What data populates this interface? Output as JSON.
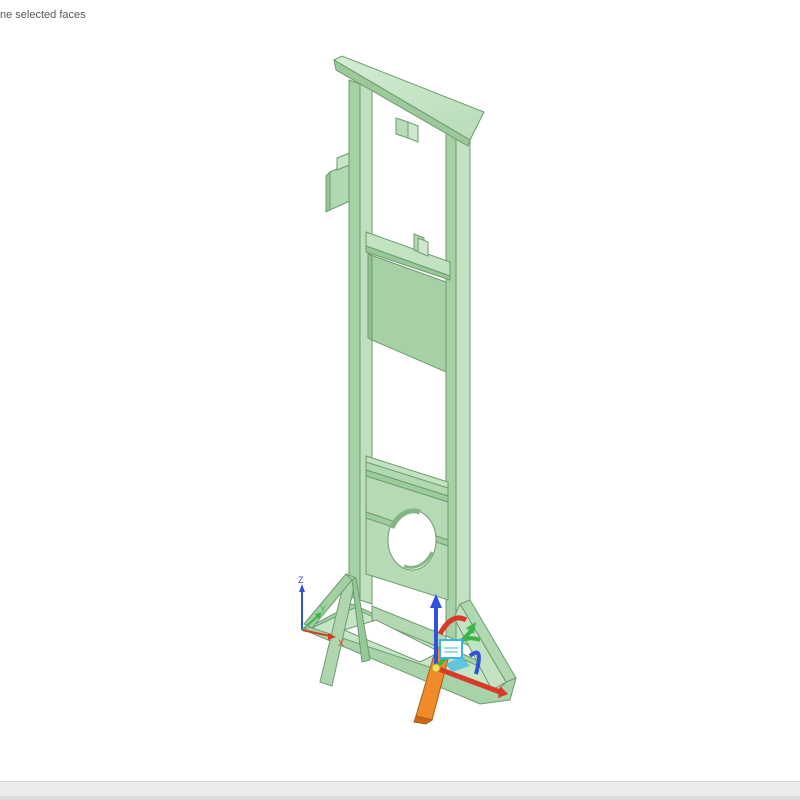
{
  "viewport": {
    "hint": "ne selected faces"
  },
  "triad": {
    "z_label": "Z",
    "x_label": "X",
    "y_label": "Y"
  },
  "colors": {
    "model_face_light": "#c8e6c8",
    "model_face_mid": "#a9d3a9",
    "model_face_dark": "#8fbf8f",
    "model_edge": "#6f9a6f",
    "gizmo_orange": "#f08020",
    "gizmo_red": "#d83a2a",
    "gizmo_green": "#3bb54a",
    "gizmo_blue": "#2f52d8",
    "gizmo_cyan": "#37b8e8",
    "status_bar": "#ececec"
  }
}
